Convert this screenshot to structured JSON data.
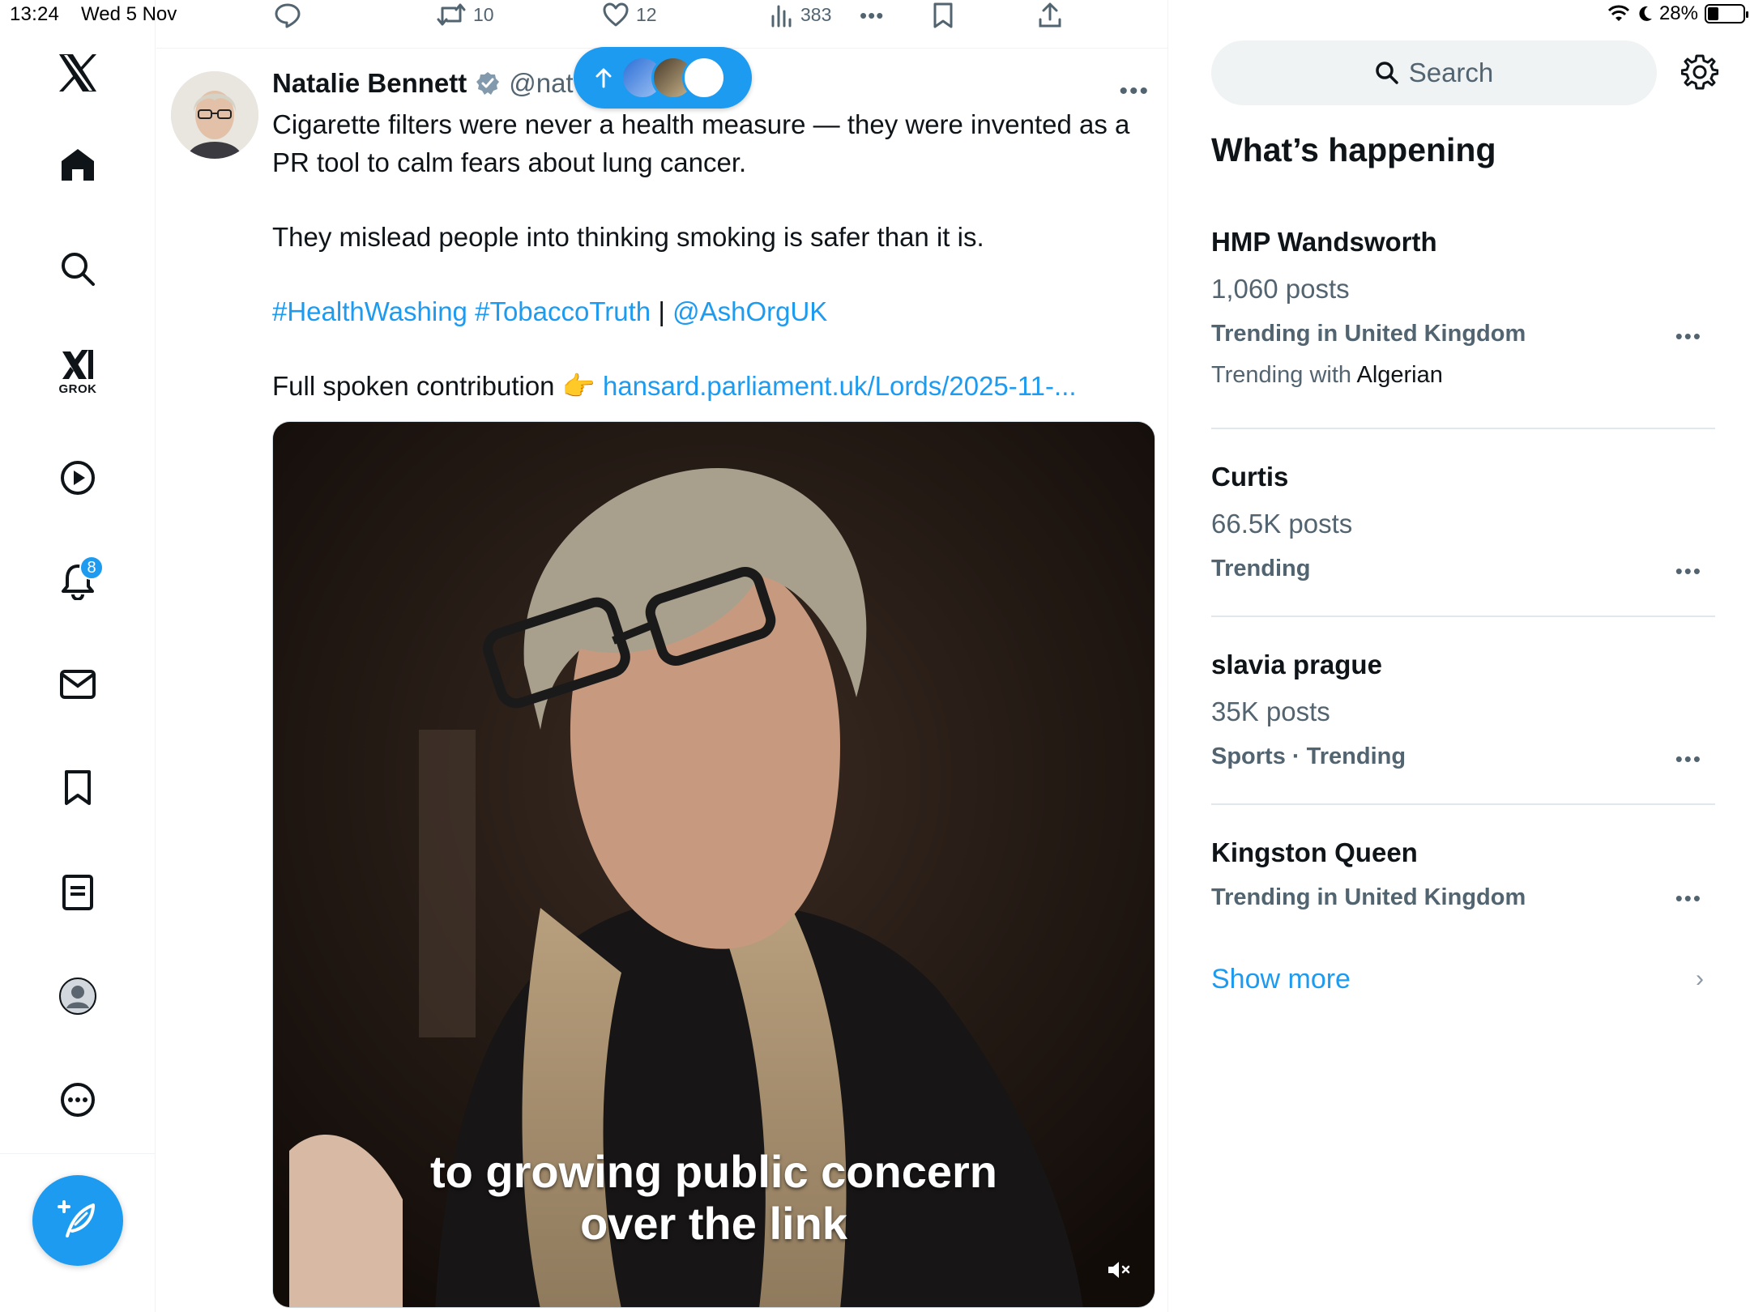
{
  "status": {
    "time": "13:24",
    "date": "Wed 5 Nov",
    "battery": "28%"
  },
  "nav": {
    "grok_label": "GROK",
    "notifications_badge": "8",
    "items": [
      "x-logo",
      "home-icon",
      "search-icon",
      "grok-icon",
      "video-icon",
      "notifications-icon",
      "messages-icon",
      "bookmarks-icon",
      "lists-icon",
      "profile-icon",
      "more-icon"
    ]
  },
  "actions": {
    "retweets": "10",
    "likes": "12",
    "views": "383",
    "more": "•••"
  },
  "tweet": {
    "author_name": "Natalie Bennett",
    "author_handle": "@nat",
    "more": "•••",
    "paragraph1": "Cigarette filters were never a health measure — they were invented as a PR tool to calm fears about lung cancer.",
    "paragraph2": "They mislead people into thinking smoking is safer than it is.",
    "hashtag1": "#HealthWashing",
    "hashtag2": "#TobaccoTruth",
    "separator": "|",
    "mention": "@AshOrgUK",
    "contribution_prefix": "Full spoken contribution",
    "contribution_emoji": "👉",
    "contribution_link": "hansard.parliament.uk/Lords/2025-11-...",
    "caption_line1": "to growing public concern",
    "caption_line2": "over the link"
  },
  "sidebar": {
    "search_placeholder": "Search",
    "title": "What’s happening",
    "trends": [
      {
        "name": "HMP Wandsworth",
        "posts": "1,060 posts",
        "context": "Trending in United Kingdom",
        "with_prefix": "Trending with",
        "with_value": "Algerian"
      },
      {
        "name": "Curtis",
        "posts": "66.5K posts",
        "context": "Trending"
      },
      {
        "name": "slavia prague",
        "posts": "35K posts",
        "context": "Sports · Trending"
      },
      {
        "name": "Kingston Queen",
        "context": "Trending in United Kingdom"
      }
    ],
    "show_more": "Show more",
    "dots": "•••"
  },
  "colors": {
    "accent": "#1d9bf0",
    "text": "#0f1419",
    "secondary": "#536471"
  }
}
